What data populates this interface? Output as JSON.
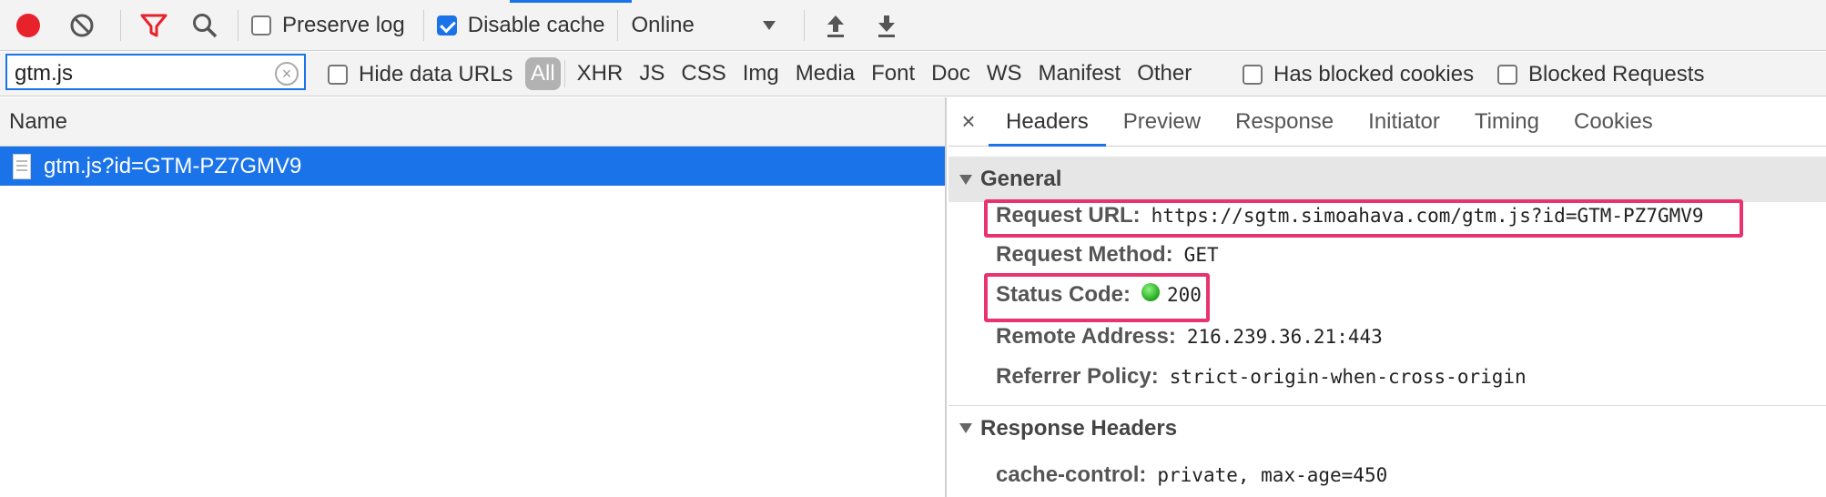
{
  "toolbar": {
    "preserve_log_label": "Preserve log",
    "preserve_log_checked": false,
    "disable_cache_label": "Disable cache",
    "disable_cache_checked": true,
    "throttling_value": "Online",
    "icons": [
      "record-icon",
      "clear-icon",
      "filter-icon",
      "search-icon",
      "import-icon",
      "export-icon"
    ]
  },
  "filterbar": {
    "filter_value": "gtm.js",
    "hide_data_urls_label": "Hide data URLs",
    "type_filters": [
      "All",
      "XHR",
      "JS",
      "CSS",
      "Img",
      "Media",
      "Font",
      "Doc",
      "WS",
      "Manifest",
      "Other"
    ],
    "has_blocked_cookies_label": "Has blocked cookies",
    "blocked_requests_label": "Blocked Requests"
  },
  "request_list": {
    "column_header": "Name",
    "rows": [
      {
        "name": "gtm.js?id=GTM-PZ7GMV9",
        "selected": true
      }
    ]
  },
  "details": {
    "tabs": [
      "Headers",
      "Preview",
      "Response",
      "Initiator",
      "Timing",
      "Cookies"
    ],
    "active_tab": "Headers",
    "general": {
      "title": "General",
      "request_url_key": "Request URL:",
      "request_url": "https://sgtm.simoahava.com/gtm.js?id=GTM-PZ7GMV9",
      "request_method_key": "Request Method:",
      "request_method": "GET",
      "status_code_key": "Status Code:",
      "status_code": "200",
      "remote_address_key": "Remote Address:",
      "remote_address": "216.239.36.21:443",
      "referrer_policy_key": "Referrer Policy:",
      "referrer_policy": "strict-origin-when-cross-origin"
    },
    "response_headers": {
      "title": "Response Headers",
      "cache_control_key": "cache-control:",
      "cache_control": "private, max-age=450"
    }
  },
  "colors": {
    "accent": "#1a73e8",
    "record": "#e8222a",
    "filter_active": "#e8222a",
    "highlight": "#e8336e",
    "status_ok": "#1fa51f"
  }
}
